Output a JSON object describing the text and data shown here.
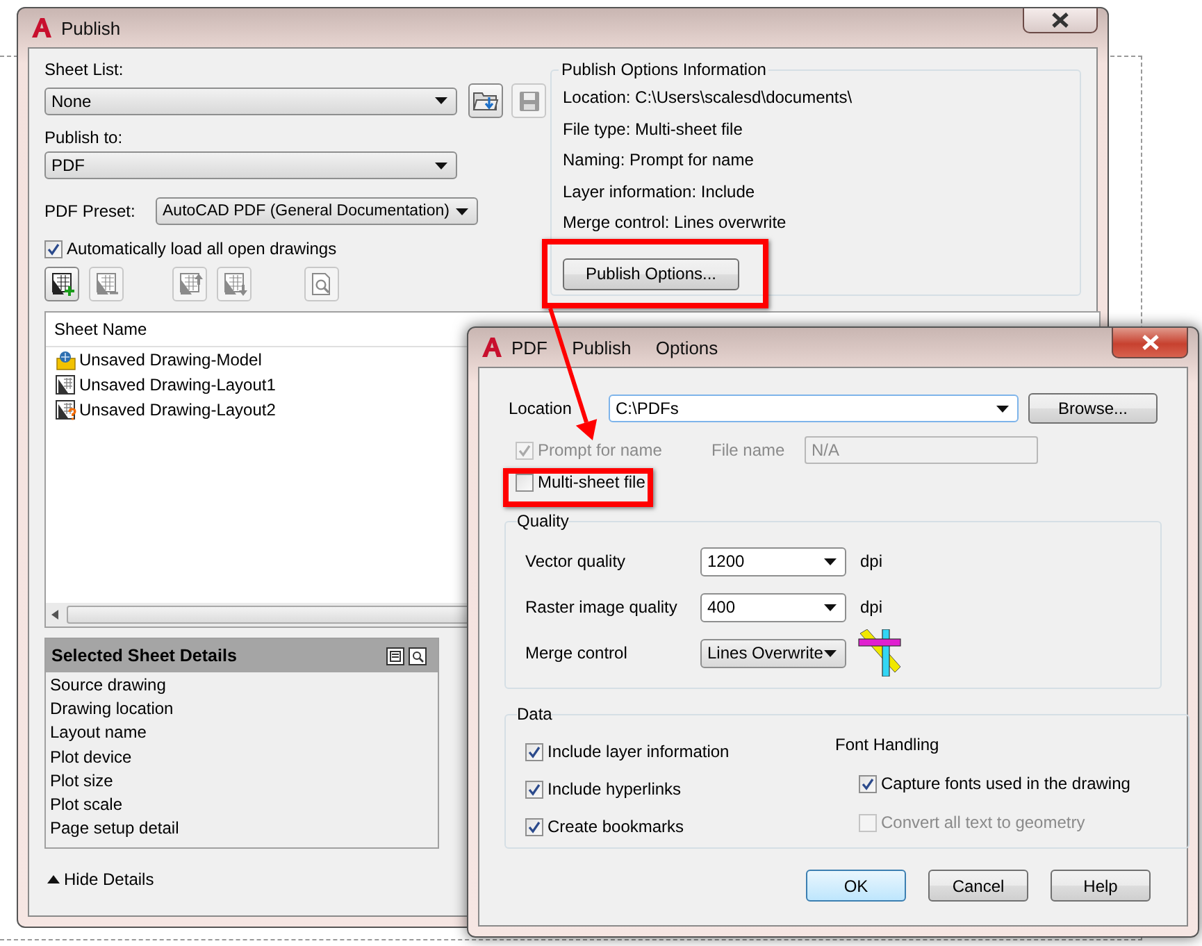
{
  "publish_window": {
    "title": "Publish",
    "sheet_list": {
      "label": "Sheet List:",
      "value": "None"
    },
    "publish_to": {
      "label": "Publish to:",
      "value": "PDF"
    },
    "pdf_preset": {
      "label": "PDF Preset:",
      "value": "AutoCAD PDF (General Documentation)"
    },
    "auto_load": {
      "label": "Automatically load all open drawings",
      "checked": true
    },
    "tools": [
      {
        "kind": "add",
        "disabled": false
      },
      {
        "kind": "remove",
        "disabled": true
      },
      {
        "kind": "up",
        "disabled": true
      },
      {
        "kind": "down",
        "disabled": true
      },
      {
        "kind": "preview",
        "disabled": true
      }
    ],
    "sheet_table": {
      "columns": [
        "Sheet Name"
      ],
      "rows": [
        {
          "name": "Unsaved Drawing-Model",
          "kind": "model"
        },
        {
          "name": "Unsaved Drawing-Layout1",
          "kind": "layout"
        },
        {
          "name": "Unsaved Drawing-Layout2",
          "kind": "layout_unknown"
        }
      ]
    },
    "details": {
      "title": "Selected Sheet Details",
      "items": [
        "Source drawing",
        "Drawing location",
        "Layout name",
        "Plot device",
        "Plot size",
        "Plot scale",
        "Page setup detail"
      ]
    },
    "hide_details": "Hide Details",
    "info": {
      "title": "Publish Options Information",
      "lines": [
        "Location: C:\\Users\\scalesd\\documents\\",
        "File type: Multi-sheet file",
        "Naming: Prompt for name",
        "Layer information: Include",
        "Merge control: Lines overwrite"
      ]
    },
    "publish_options_button": "Publish Options..."
  },
  "pdf_dialog": {
    "title": "PDF Publish Options",
    "location": {
      "label": "Location",
      "value": "C:\\PDFs"
    },
    "browse_button": "Browse...",
    "prompt_for_name": {
      "label": "Prompt for name",
      "checked": true,
      "disabled": true
    },
    "file_name": {
      "label": "File name",
      "value": "N/A",
      "disabled": true
    },
    "multi_sheet": {
      "label": "Multi-sheet file",
      "checked": false,
      "disabled": false
    },
    "quality": {
      "title": "Quality",
      "rows": [
        {
          "label": "Vector quality",
          "value": "1200",
          "unit": "dpi",
          "kind": "unit"
        },
        {
          "label": "Raster image quality",
          "value": "400",
          "unit": "dpi",
          "kind": "unit"
        },
        {
          "label": "Merge control",
          "value": "Lines Overwrite",
          "kind": "merge"
        }
      ]
    },
    "data": {
      "title": "Data",
      "options": [
        {
          "label": "Include layer information",
          "checked": true,
          "disabled": false
        },
        {
          "label": "Include hyperlinks",
          "checked": true,
          "disabled": false
        },
        {
          "label": "Create bookmarks",
          "checked": true,
          "disabled": false
        }
      ],
      "font_handling": {
        "title": "Font Handling",
        "options": [
          {
            "label": "Capture fonts used in the drawing",
            "checked": true,
            "disabled": false
          },
          {
            "label": "Convert all text to geometry",
            "checked": false,
            "disabled": true
          }
        ]
      }
    },
    "buttons": [
      "OK",
      "Cancel",
      "Help"
    ]
  }
}
